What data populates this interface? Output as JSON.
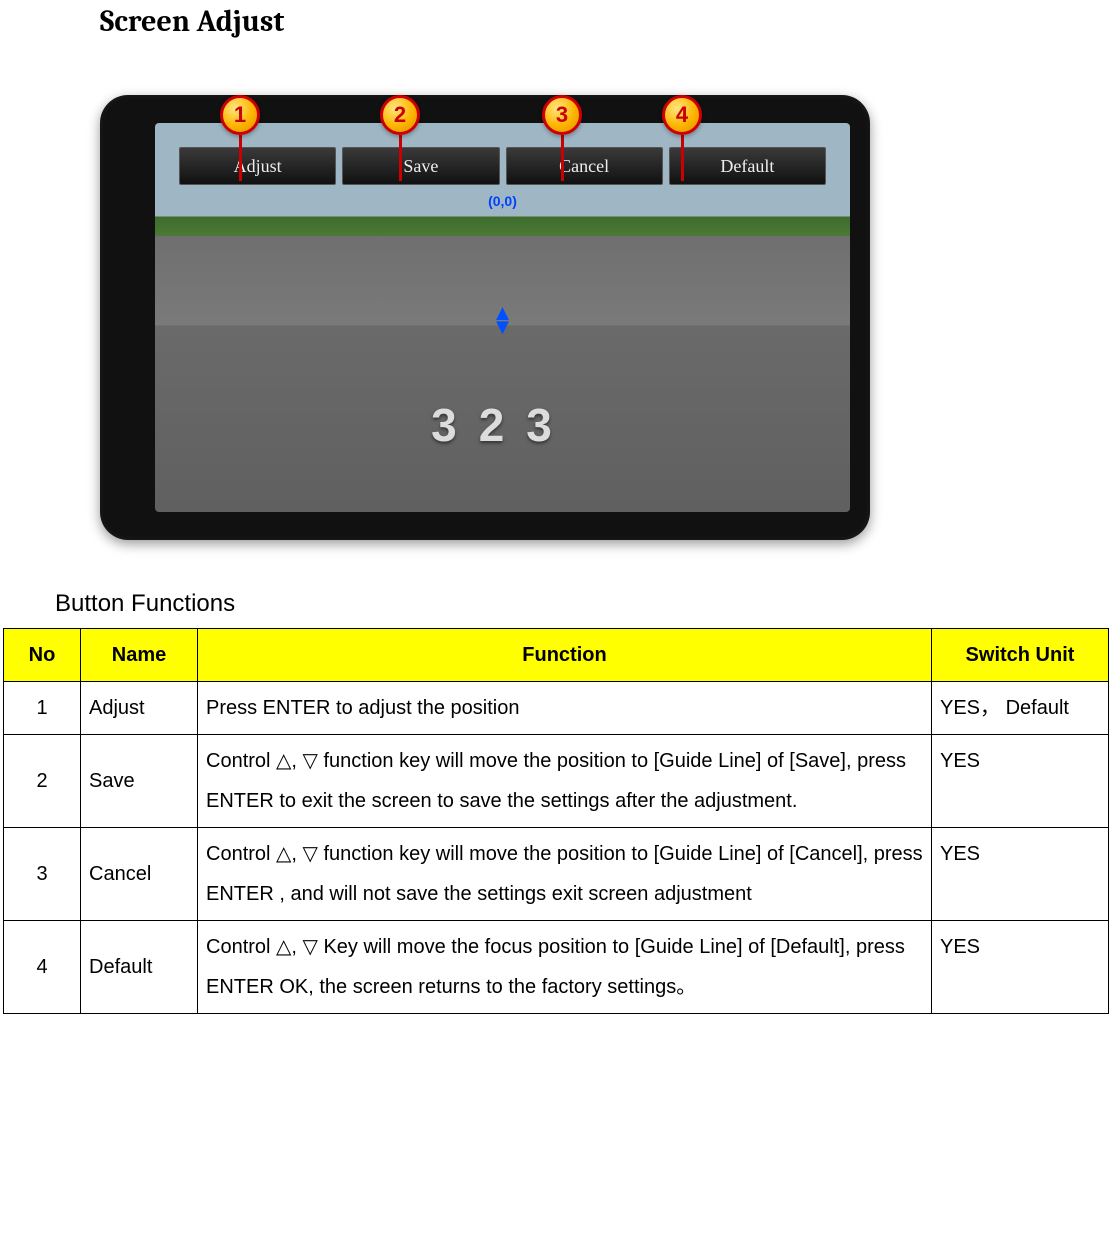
{
  "title": "Screen Adjust",
  "callouts": [
    "1",
    "2",
    "3",
    "4"
  ],
  "menu": {
    "adjust": "Adjust",
    "save": "Save",
    "cancel": "Cancel",
    "default": "Default"
  },
  "screen": {
    "coord": "(0,0)",
    "pavement_number": "323"
  },
  "subtitle": "Button Functions",
  "table": {
    "headers": {
      "no": "No",
      "name": "Name",
      "func": "Function",
      "switch": "Switch Unit"
    },
    "rows": [
      {
        "no": "1",
        "name": "Adjust",
        "func": "Press ENTER to adjust the position",
        "switch": "YES， Default"
      },
      {
        "no": "2",
        "name": "Save",
        "func": "Control △, ▽ function key will move the position to [Guide Line] of [Save], press ENTER to exit the screen to save the settings after the adjustment.",
        "switch": "YES"
      },
      {
        "no": "3",
        "name": "Cancel",
        "func": "Control △, ▽ function key will move the position to [Guide Line] of [Cancel], press ENTER , and will not save the settings exit screen adjustment",
        "switch": "YES"
      },
      {
        "no": "4",
        "name": "Default",
        "func": "Control △, ▽ Key will move the focus position to [Guide Line] of [Default], press ENTER OK, the screen returns to the factory settings。",
        "switch": "YES"
      }
    ]
  }
}
